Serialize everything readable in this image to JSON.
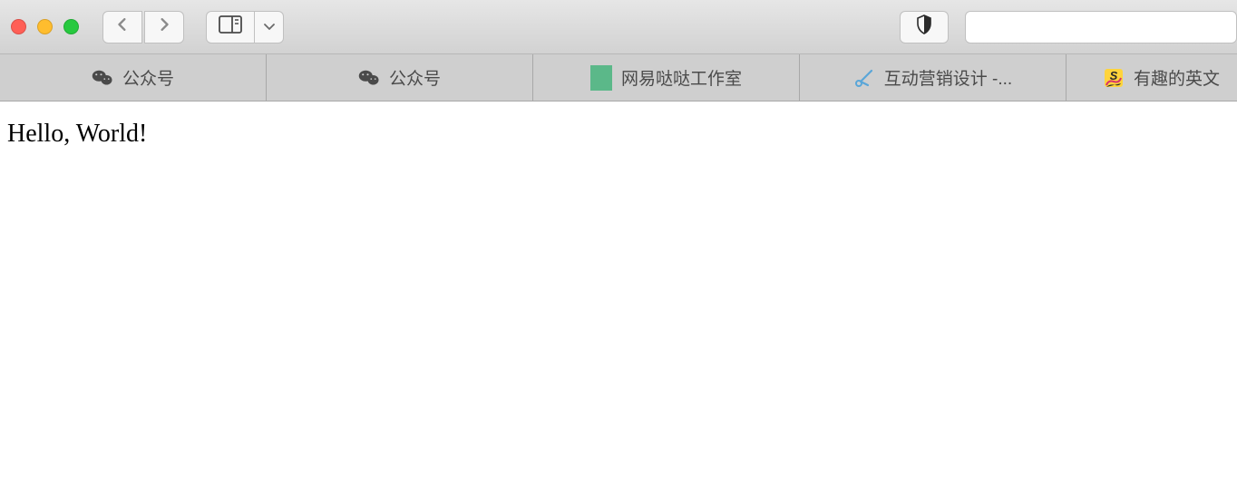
{
  "tabs": [
    {
      "label": "公众号",
      "icon": "wechat"
    },
    {
      "label": "公众号",
      "icon": "wechat"
    },
    {
      "label": "网易哒哒工作室",
      "icon": "green-square"
    },
    {
      "label": "互动营销设计 -...",
      "icon": "scissors"
    },
    {
      "label": "有趣的英文",
      "icon": "sogou"
    }
  ],
  "page": {
    "body_text": "Hello, World!"
  }
}
